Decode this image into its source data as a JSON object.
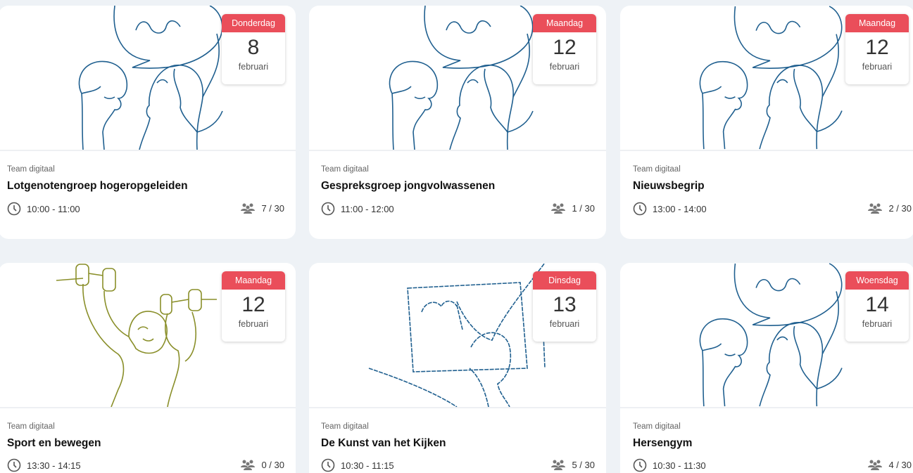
{
  "colors": {
    "accent": "#ea4e5a",
    "line_blue": "#1f5f8f",
    "line_olive": "#8a8f2a"
  },
  "cards": [
    {
      "team": "Team digitaal",
      "title": "Lotgenotengroep hogeropgeleiden",
      "day": "Donderdag",
      "date": "8",
      "month": "februari",
      "time": "10:00 - 11:00",
      "capacity": "7 / 30",
      "illustration": "two-people-talking-icon"
    },
    {
      "team": "Team digitaal",
      "title": "Gespreksgroep jongvolwassenen",
      "day": "Maandag",
      "date": "12",
      "month": "februari",
      "time": "11:00 - 12:00",
      "capacity": "1 / 30",
      "illustration": "two-people-talking-icon"
    },
    {
      "team": "Team digitaal",
      "title": "Nieuwsbegrip",
      "day": "Maandag",
      "date": "12",
      "month": "februari",
      "time": "13:00 - 14:00",
      "capacity": "2 / 30",
      "illustration": "two-people-talking-icon"
    },
    {
      "team": "Team digitaal",
      "title": "Sport en bewegen",
      "day": "Maandag",
      "date": "12",
      "month": "februari",
      "time": "13:30 - 14:15",
      "capacity": "0 / 30",
      "illustration": "person-lifting-weights-icon"
    },
    {
      "team": "Team digitaal",
      "title": "De Kunst van het Kijken",
      "day": "Dinsdag",
      "date": "13",
      "month": "februari",
      "time": "10:30 - 11:15",
      "capacity": "5 / 30",
      "illustration": "person-painting-icon"
    },
    {
      "team": "Team digitaal",
      "title": "Hersengym",
      "day": "Woensdag",
      "date": "14",
      "month": "februari",
      "time": "10:30 - 11:30",
      "capacity": "4 / 30",
      "illustration": "two-people-talking-icon"
    }
  ]
}
